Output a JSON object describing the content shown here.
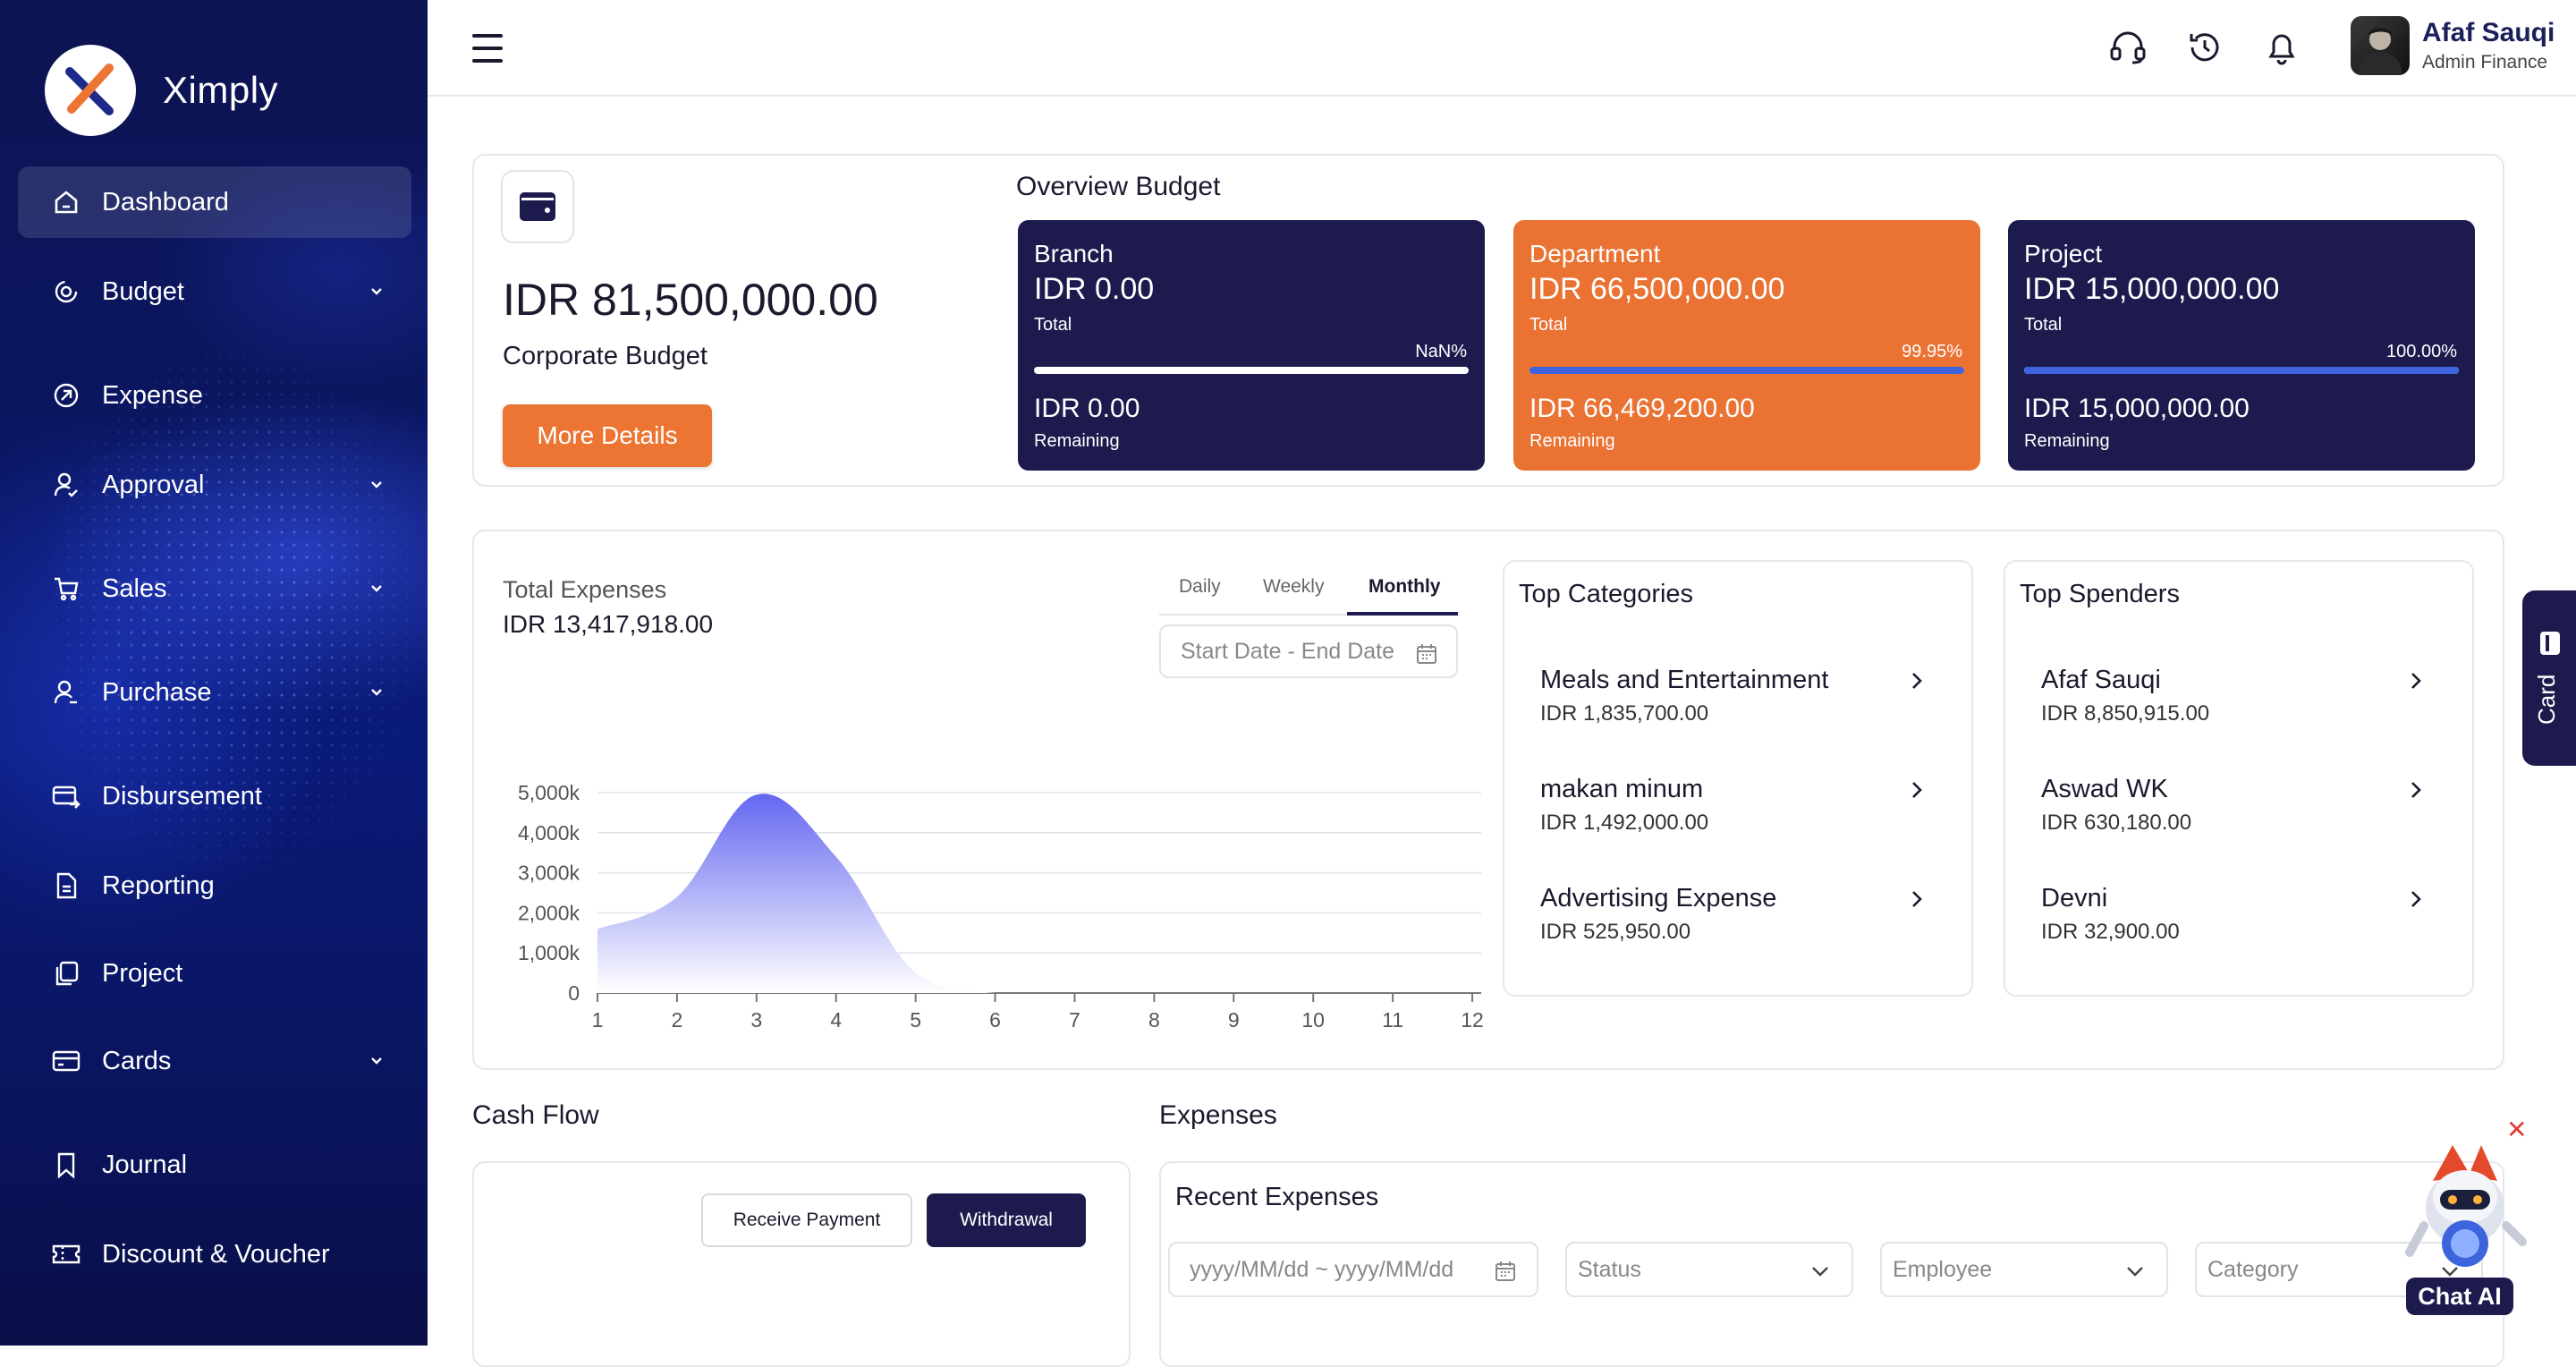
{
  "brand": {
    "name": "Ximply"
  },
  "sidebar": {
    "items": [
      {
        "label": "Dashboard",
        "icon": "home-icon",
        "active": true,
        "has_chevron": false
      },
      {
        "label": "Budget",
        "icon": "budget-icon",
        "active": false,
        "has_chevron": true
      },
      {
        "label": "Expense",
        "icon": "expense-icon",
        "active": false,
        "has_chevron": false
      },
      {
        "label": "Approval",
        "icon": "user-check-icon",
        "active": false,
        "has_chevron": true
      },
      {
        "label": "Sales",
        "icon": "cart-icon",
        "active": false,
        "has_chevron": true
      },
      {
        "label": "Purchase",
        "icon": "user-purchase-icon",
        "active": false,
        "has_chevron": true
      },
      {
        "label": "Disbursement",
        "icon": "disbursement-icon",
        "active": false,
        "has_chevron": false
      },
      {
        "label": "Reporting",
        "icon": "document-icon",
        "active": false,
        "has_chevron": false
      },
      {
        "label": "Project",
        "icon": "copy-icon",
        "active": false,
        "has_chevron": false
      },
      {
        "label": "Cards",
        "icon": "card-icon",
        "active": false,
        "has_chevron": true
      },
      {
        "label": "Journal",
        "icon": "bookmark-icon",
        "active": false,
        "has_chevron": false
      },
      {
        "label": "Discount & Voucher",
        "icon": "ticket-icon",
        "active": false,
        "has_chevron": false
      }
    ]
  },
  "header": {
    "icons": [
      "headset-icon",
      "history-icon",
      "bell-icon"
    ],
    "user": {
      "name": "Afaf Sauqi",
      "role": "Admin Finance"
    }
  },
  "corporate": {
    "amount": "IDR 81,500,000.00",
    "label": "Corporate Budget",
    "button": "More Details"
  },
  "overview": {
    "title": "Overview Budget",
    "cards": [
      {
        "name": "Branch",
        "total": "IDR 0.00",
        "total_label": "Total",
        "pct_label": "NaN%",
        "fill": 0,
        "remaining": "IDR 0.00",
        "remaining_label": "Remaining",
        "color": "#1d1b4e"
      },
      {
        "name": "Department",
        "total": "IDR 66,500,000.00",
        "total_label": "Total",
        "pct_label": "99.95%",
        "fill": 0.9995,
        "remaining": "IDR 66,469,200.00",
        "remaining_label": "Remaining",
        "color": "#ea7232"
      },
      {
        "name": "Project",
        "total": "IDR 15,000,000.00",
        "total_label": "Total",
        "pct_label": "100.00%",
        "fill": 1.0,
        "remaining": "IDR 15,000,000.00",
        "remaining_label": "Remaining",
        "color": "#1d1b4e"
      }
    ]
  },
  "expenses_summary": {
    "label": "Total Expenses",
    "value": "IDR 13,417,918.00",
    "tabs": [
      "Daily",
      "Weekly",
      "Monthly"
    ],
    "active_tab": "Monthly",
    "date_placeholder": "Start Date - End Date"
  },
  "chart_data": {
    "type": "area",
    "x": [
      1,
      2,
      3,
      4,
      5,
      6,
      7,
      8,
      9,
      10,
      11,
      12
    ],
    "y_ticks": [
      "0",
      "1,000k",
      "2,000k",
      "3,000k",
      "4,000k",
      "5,000k"
    ],
    "x_ticks": [
      "1",
      "2",
      "3",
      "4",
      "5",
      "6",
      "7",
      "8",
      "9",
      "10",
      "11",
      "12"
    ],
    "series": [
      {
        "values": [
          1600,
          2400,
          4950,
          3400,
          500,
          0,
          0,
          0,
          0,
          0,
          0,
          0
        ]
      }
    ],
    "ylim": [
      0,
      5000
    ],
    "unit": "k",
    "grid": true,
    "fill_color": "#6d6ff0"
  },
  "top_categories": {
    "title": "Top Categories",
    "items": [
      {
        "name": "Meals and Entertainment",
        "amount": "IDR 1,835,700.00"
      },
      {
        "name": "makan minum",
        "amount": "IDR 1,492,000.00"
      },
      {
        "name": "Advertising Expense",
        "amount": "IDR 525,950.00"
      }
    ]
  },
  "top_spenders": {
    "title": "Top Spenders",
    "items": [
      {
        "name": "Afaf Sauqi",
        "amount": "IDR 8,850,915.00"
      },
      {
        "name": "Aswad WK",
        "amount": "IDR 630,180.00"
      },
      {
        "name": "Devni",
        "amount": "IDR 32,900.00"
      }
    ]
  },
  "cash_flow": {
    "title": "Cash Flow",
    "buttons": [
      "Receive Payment",
      "Withdrawal"
    ]
  },
  "expenses_section": {
    "title": "Expenses",
    "recent_title": "Recent Expenses",
    "date_placeholder": "yyyy/MM/dd ~ yyyy/MM/dd",
    "filters": [
      "Status",
      "Employee",
      "Category"
    ]
  },
  "side_tab": {
    "label": "Card"
  },
  "chat": {
    "label": "Chat AI"
  },
  "colors": {
    "navy": "#1d1b4e",
    "orange": "#ea7232",
    "accent_blue": "#3d63dd"
  }
}
